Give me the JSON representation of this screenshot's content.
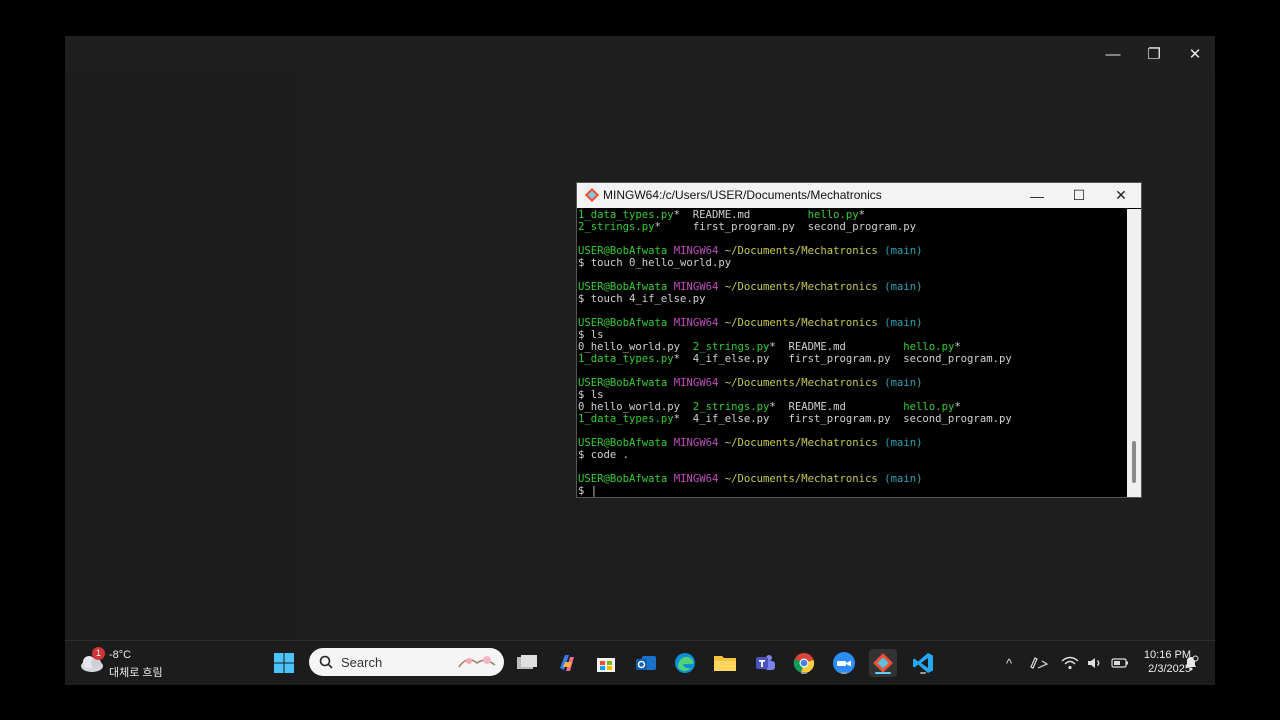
{
  "outer_window": {
    "controls": {
      "minimize": "—",
      "restore": "❐",
      "close": "✕"
    }
  },
  "terminal": {
    "title": "MINGW64:/c/Users/USER/Documents/Mechatronics",
    "controls": {
      "minimize": "—",
      "maximize": "☐",
      "close": "✕"
    },
    "lines": [
      [
        {
          "t": "1_data_types.py",
          "c": "green"
        },
        {
          "t": "*  README.md         ",
          "c": "white"
        },
        {
          "t": "hello.py",
          "c": "green"
        },
        {
          "t": "*",
          "c": "white"
        }
      ],
      [
        {
          "t": "2_strings.py",
          "c": "green"
        },
        {
          "t": "*     first_program.py  second_program.py",
          "c": "white"
        }
      ],
      [],
      [
        {
          "t": "USER@BobAfwata",
          "c": "green"
        },
        {
          "t": " ",
          "c": "white"
        },
        {
          "t": "MINGW64",
          "c": "purple"
        },
        {
          "t": " ",
          "c": "white"
        },
        {
          "t": "~/Documents/Mechatronics",
          "c": "yellow"
        },
        {
          "t": " ",
          "c": "white"
        },
        {
          "t": "(main)",
          "c": "cyan"
        }
      ],
      [
        {
          "t": "$ touch 0_hello_world.py",
          "c": "white"
        }
      ],
      [],
      [
        {
          "t": "USER@BobAfwata",
          "c": "green"
        },
        {
          "t": " ",
          "c": "white"
        },
        {
          "t": "MINGW64",
          "c": "purple"
        },
        {
          "t": " ",
          "c": "white"
        },
        {
          "t": "~/Documents/Mechatronics",
          "c": "yellow"
        },
        {
          "t": " ",
          "c": "white"
        },
        {
          "t": "(main)",
          "c": "cyan"
        }
      ],
      [
        {
          "t": "$ touch 4_if_else.py",
          "c": "white"
        }
      ],
      [],
      [
        {
          "t": "USER@BobAfwata",
          "c": "green"
        },
        {
          "t": " ",
          "c": "white"
        },
        {
          "t": "MINGW64",
          "c": "purple"
        },
        {
          "t": " ",
          "c": "white"
        },
        {
          "t": "~/Documents/Mechatronics",
          "c": "yellow"
        },
        {
          "t": " ",
          "c": "white"
        },
        {
          "t": "(main)",
          "c": "cyan"
        }
      ],
      [
        {
          "t": "$ ls",
          "c": "white"
        }
      ],
      [
        {
          "t": "0_hello_world.py  ",
          "c": "white"
        },
        {
          "t": "2_strings.py",
          "c": "green"
        },
        {
          "t": "*  README.md         ",
          "c": "white"
        },
        {
          "t": "hello.py",
          "c": "green"
        },
        {
          "t": "*",
          "c": "white"
        }
      ],
      [
        {
          "t": "1_data_types.py",
          "c": "green"
        },
        {
          "t": "*  4_if_else.py   first_program.py  second_program.py",
          "c": "white"
        }
      ],
      [],
      [
        {
          "t": "USER@BobAfwata",
          "c": "green"
        },
        {
          "t": " ",
          "c": "white"
        },
        {
          "t": "MINGW64",
          "c": "purple"
        },
        {
          "t": " ",
          "c": "white"
        },
        {
          "t": "~/Documents/Mechatronics",
          "c": "yellow"
        },
        {
          "t": " ",
          "c": "white"
        },
        {
          "t": "(main)",
          "c": "cyan"
        }
      ],
      [
        {
          "t": "$ ls",
          "c": "white"
        }
      ],
      [
        {
          "t": "0_hello_world.py  ",
          "c": "white"
        },
        {
          "t": "2_strings.py",
          "c": "green"
        },
        {
          "t": "*  README.md         ",
          "c": "white"
        },
        {
          "t": "hello.py",
          "c": "green"
        },
        {
          "t": "*",
          "c": "white"
        }
      ],
      [
        {
          "t": "1_data_types.py",
          "c": "green"
        },
        {
          "t": "*  4_if_else.py   first_program.py  second_program.py",
          "c": "white"
        }
      ],
      [],
      [
        {
          "t": "USER@BobAfwata",
          "c": "green"
        },
        {
          "t": " ",
          "c": "white"
        },
        {
          "t": "MINGW64",
          "c": "purple"
        },
        {
          "t": " ",
          "c": "white"
        },
        {
          "t": "~/Documents/Mechatronics",
          "c": "yellow"
        },
        {
          "t": " ",
          "c": "white"
        },
        {
          "t": "(main)",
          "c": "cyan"
        }
      ],
      [
        {
          "t": "$ code .",
          "c": "white"
        }
      ],
      [],
      [
        {
          "t": "USER@BobAfwata",
          "c": "green"
        },
        {
          "t": " ",
          "c": "white"
        },
        {
          "t": "MINGW64",
          "c": "purple"
        },
        {
          "t": " ",
          "c": "white"
        },
        {
          "t": "~/Documents/Mechatronics",
          "c": "yellow"
        },
        {
          "t": " ",
          "c": "white"
        },
        {
          "t": "(main)",
          "c": "cyan"
        }
      ],
      [
        {
          "t": "$ |",
          "c": "white"
        }
      ]
    ]
  },
  "taskbar": {
    "weather": {
      "temp": "-8°C",
      "desc": "대체로 흐림",
      "badge": "1"
    },
    "search_placeholder": "Search",
    "apps": [
      "windows-start",
      "search",
      "task-view",
      "copilot",
      "microsoft-store",
      "outlook",
      "edge",
      "file-explorer",
      "teams",
      "chrome",
      "zoom",
      "git-bash",
      "vscode"
    ],
    "tray": {
      "chevron": "^",
      "clock_time": "10:16 PM",
      "clock_date": "2/3/2025"
    }
  },
  "colors": {
    "green": "#33cc33",
    "purple": "#bf4fbf",
    "yellow": "#c8c850",
    "cyan": "#2aa1b3",
    "accent": "#60cdff"
  }
}
